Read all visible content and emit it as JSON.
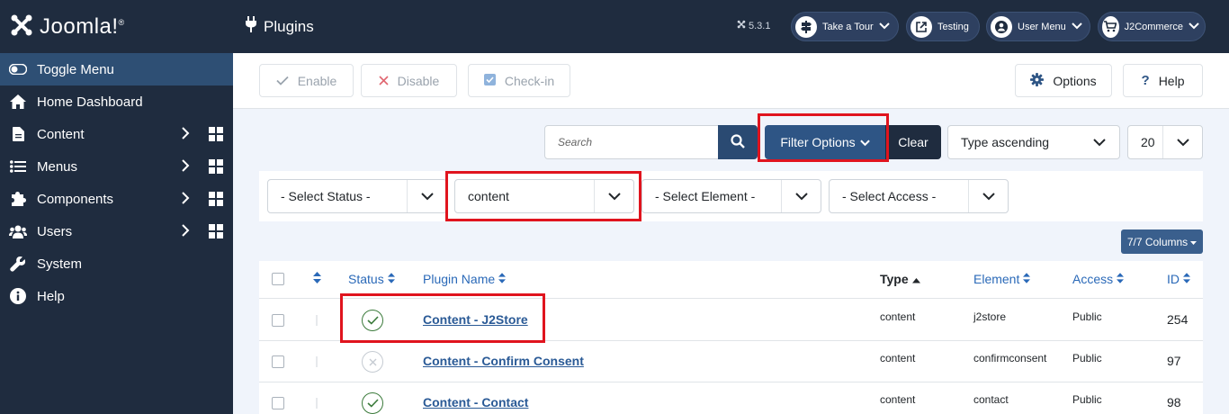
{
  "brand": {
    "name": "Joomla!"
  },
  "sidebar": {
    "items": [
      {
        "label": "Toggle Menu",
        "icon": "toggle-icon"
      },
      {
        "label": "Home Dashboard",
        "icon": "home-icon"
      },
      {
        "label": "Content",
        "icon": "file-icon"
      },
      {
        "label": "Menus",
        "icon": "list-icon"
      },
      {
        "label": "Components",
        "icon": "puzzle-icon"
      },
      {
        "label": "Users",
        "icon": "users-icon"
      },
      {
        "label": "System",
        "icon": "wrench-icon"
      },
      {
        "label": "Help",
        "icon": "info-icon"
      }
    ]
  },
  "header": {
    "title": "Plugins",
    "version": "5.3.1",
    "buttons": [
      {
        "label": "Take a Tour",
        "icon": "signpost-icon"
      },
      {
        "label": "Testing",
        "icon": "external-link-icon"
      },
      {
        "label": "User Menu",
        "icon": "user-icon"
      },
      {
        "label": "J2Commerce",
        "icon": "cart-icon"
      }
    ]
  },
  "toolbar": {
    "enable": "Enable",
    "disable": "Disable",
    "checkin": "Check-in",
    "options": "Options",
    "help": "Help"
  },
  "search": {
    "placeholder": "Search",
    "filter_options": "Filter Options",
    "clear": "Clear",
    "sort": "Type ascending",
    "limit": "20"
  },
  "filters": {
    "status": "- Select Status -",
    "folder": "content",
    "element": "- Select Element -",
    "access": "- Select Access -"
  },
  "columns_button": "7/7 Columns",
  "table": {
    "headers": {
      "status": "Status",
      "name": "Plugin Name",
      "type": "Type",
      "element": "Element",
      "access": "Access",
      "id": "ID"
    },
    "rows": [
      {
        "name": "Content - J2Store",
        "type": "content",
        "element": "j2store",
        "access": "Public",
        "id": "254",
        "enabled": true
      },
      {
        "name": "Content - Confirm Consent",
        "type": "content",
        "element": "confirmconsent",
        "access": "Public",
        "id": "97",
        "enabled": false
      },
      {
        "name": "Content - Contact",
        "type": "content",
        "element": "contact",
        "access": "Public",
        "id": "98",
        "enabled": true
      }
    ]
  },
  "colors": {
    "sidebar_bg": "#1f2c3f",
    "highlight": "#e0141e",
    "link": "#2a5a96",
    "accent": "#2e5585"
  }
}
